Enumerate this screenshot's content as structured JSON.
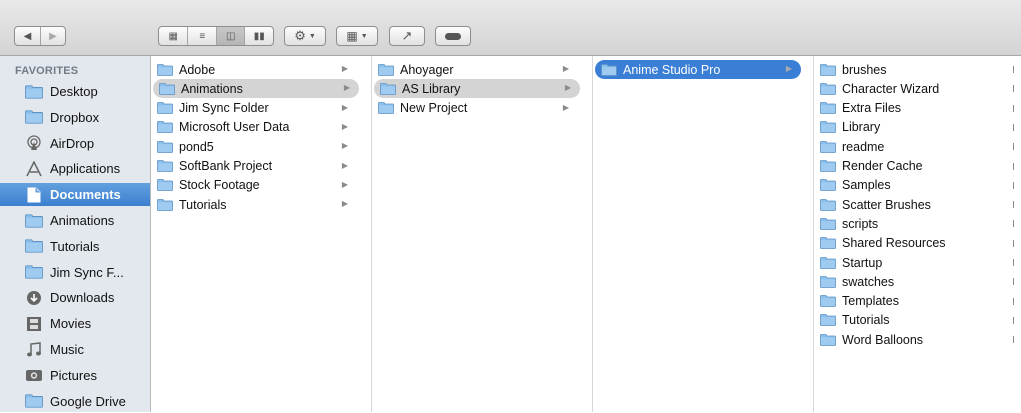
{
  "sidebar": {
    "heading": "FAVORITES",
    "items": [
      {
        "label": "Desktop",
        "icon": "folder-icon"
      },
      {
        "label": "Dropbox",
        "icon": "folder-icon"
      },
      {
        "label": "AirDrop",
        "icon": "airdrop-icon"
      },
      {
        "label": "Applications",
        "icon": "applications-icon"
      },
      {
        "label": "Documents",
        "icon": "document-icon",
        "selected": true
      },
      {
        "label": "Animations",
        "icon": "folder-icon"
      },
      {
        "label": "Tutorials",
        "icon": "folder-icon"
      },
      {
        "label": "Jim Sync F...",
        "icon": "folder-icon"
      },
      {
        "label": "Downloads",
        "icon": "downloads-icon"
      },
      {
        "label": "Movies",
        "icon": "movies-icon"
      },
      {
        "label": "Music",
        "icon": "music-icon"
      },
      {
        "label": "Pictures",
        "icon": "pictures-icon"
      },
      {
        "label": "Google Drive",
        "icon": "folder-icon"
      }
    ]
  },
  "columns": [
    {
      "items": [
        "Adobe",
        "Animations",
        "Jim Sync Folder",
        "Microsoft User Data",
        "pond5",
        "SoftBank Project",
        "Stock Footage",
        "Tutorials"
      ],
      "highlighted": 1
    },
    {
      "items": [
        "Ahoyager",
        "AS Library",
        "New Project"
      ],
      "highlighted": 1
    },
    {
      "items": [
        "Anime Studio Pro"
      ],
      "selected": 0
    },
    {
      "items": [
        "brushes",
        "Character Wizard",
        "Extra Files",
        "Library",
        "readme",
        "Render Cache",
        "Samples",
        "Scatter Brushes",
        "scripts",
        "Shared Resources",
        "Startup",
        "swatches",
        "Templates",
        "Tutorials",
        "Word Balloons"
      ]
    }
  ],
  "colors": {
    "selection": "#3a7fd5",
    "sidebar_bg": "#e3e8ee",
    "folder": "#7fb6e6"
  }
}
